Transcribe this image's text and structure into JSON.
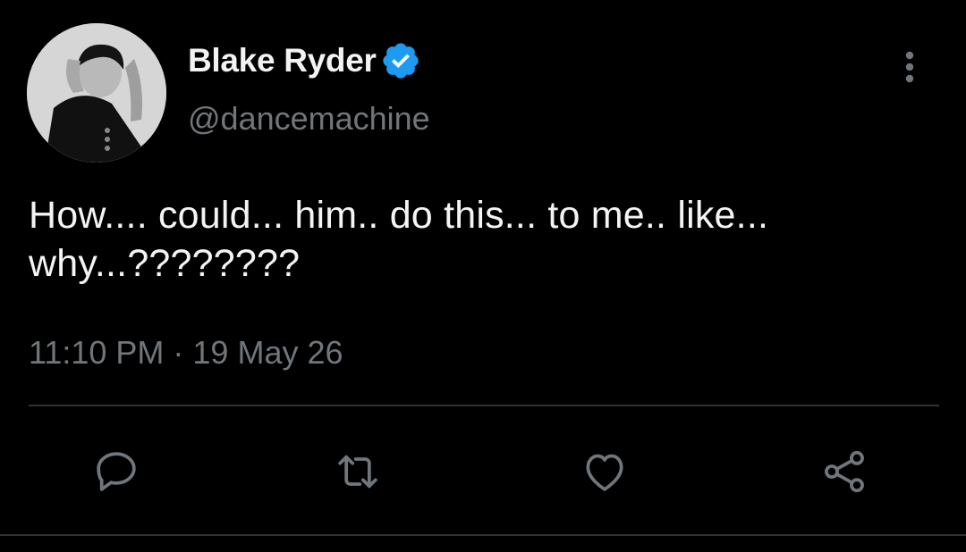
{
  "author": {
    "display_name": "Blake Ryder",
    "handle": "@dancemachine",
    "verified": true,
    "avatar_icon": "profile-photo"
  },
  "tweet": {
    "text": "How.... could... him.. do this... to me.. like... why...????????",
    "timestamp": "11:10 PM · 19 May 26"
  },
  "actions": {
    "reply_icon": "reply-icon",
    "retweet_icon": "retweet-icon",
    "like_icon": "heart-icon",
    "share_icon": "share-icon",
    "more_icon": "more-vertical-icon"
  },
  "colors": {
    "background": "#000000",
    "verified_badge": "#1d9bf0",
    "secondary_text": "#71767b",
    "icon": "#71767b",
    "divider": "#2f3336"
  }
}
